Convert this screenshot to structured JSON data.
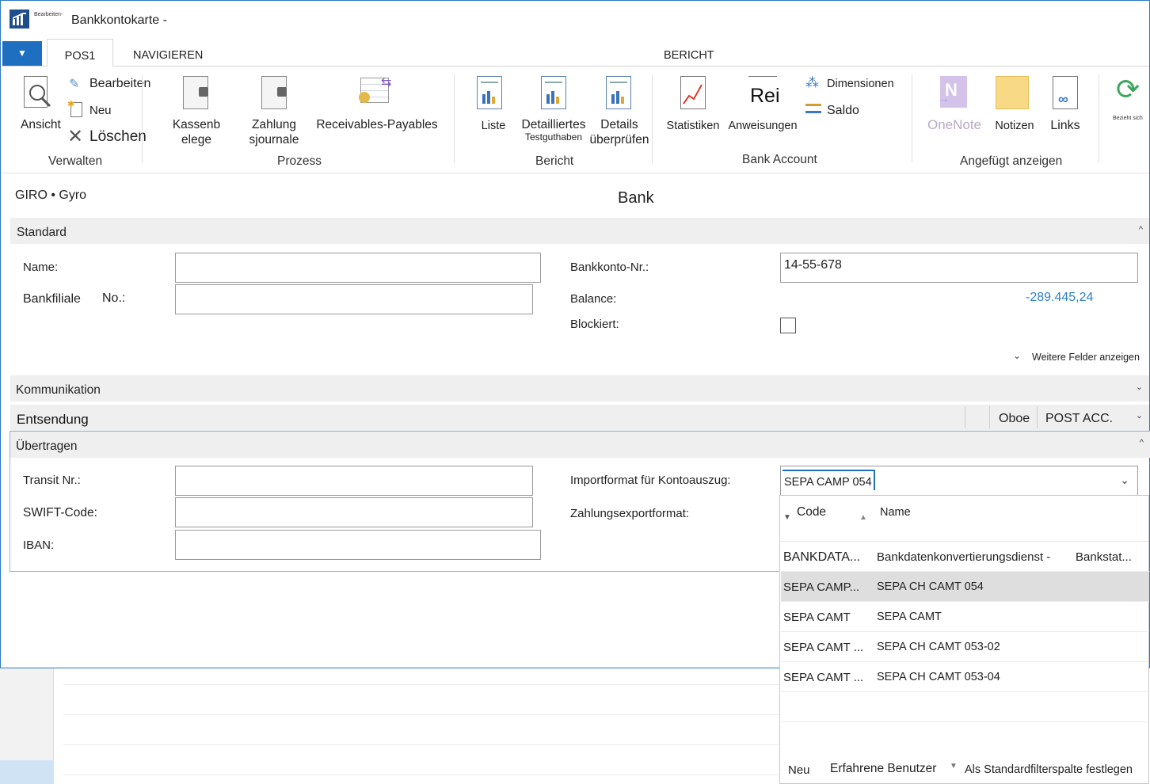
{
  "window": {
    "title": "Bankkontokarte -",
    "logo_caption": "Bearbeiten-"
  },
  "ribbon_tabs": {
    "file_icon": "chevron-down-icon",
    "tabs": [
      "POS1",
      "NAVIGIEREN",
      "BERICHT"
    ]
  },
  "ribbon": {
    "verwalten": {
      "ansicht": "Ansicht",
      "bearbeiten": "Bearbeiten",
      "neu": "Neu",
      "loeschen": "Löschen",
      "label": "Verwalten"
    },
    "prozess": {
      "kassenbelege_1": "Kassenb",
      "kassenbelege_2": "elege",
      "zahlung_1": "Zahlung",
      "zahlung_2": "sjournale",
      "receivables": "Receivables-Payables",
      "label": "Prozess"
    },
    "bericht": {
      "liste": "Liste",
      "detailliertes": "Detailliertes",
      "testguthaben": "Testguthaben",
      "details_1": "Details",
      "details_2": "überprüfen",
      "label": "Bericht"
    },
    "bank_account": {
      "statistiken": "Statistiken",
      "rei": "Rei",
      "anweisungen": "Anweisungen",
      "dimensionen": "Dimensionen",
      "saldo": "Saldo",
      "label": "Bank Account"
    },
    "angefuegt": {
      "onenote": "OneNote",
      "notizen": "Notizen",
      "links": "Links",
      "label": "Angefügt anzeigen"
    },
    "refresh_caption": "Bezieht sich"
  },
  "header": {
    "record_id": "GIRO • Gyro",
    "page_title": "Bank"
  },
  "standard": {
    "title": "Standard",
    "name_label": "Name:",
    "name_value": "",
    "bankfiliale_label": "Bankfiliale",
    "no_label": "No.:",
    "bankfiliale_value": "",
    "bankkonto_label": "Bankkonto-Nr.:",
    "bankkonto_value": "14-55-678",
    "balance_label": "Balance:",
    "balance_value": "-289.445,24",
    "blockiert_label": "Blockiert:",
    "weitere_felder": "Weitere Felder anzeigen"
  },
  "kommunikation": {
    "title": "Kommunikation"
  },
  "entsendung": {
    "title": "Entsendung",
    "oboe": "Oboe",
    "post_acc": "POST ACC."
  },
  "uebertragen": {
    "title": "Übertragen",
    "transit_label": "Transit Nr.:",
    "swift_label": "SWIFT-Code:",
    "iban_label": "IBAN:",
    "importformat_label": "Importformat für Kontoauszug:",
    "importformat_value": "SEPA CAMP 054",
    "zahlungsexport_label": "Zahlungsexportformat:"
  },
  "dropdown": {
    "col_code": "Code",
    "col_name": "Name",
    "rows": [
      {
        "code": "BANKDATA...",
        "name": "Bankdatenkonvertierungsdienst -",
        "extra": "Bankstat..."
      },
      {
        "code": "SEPA CAMP...",
        "name": "SEPA CH CAMT 054",
        "extra": ""
      },
      {
        "code": "SEPA CAMT",
        "name": "SEPA CAMT",
        "extra": ""
      },
      {
        "code": "SEPA CAMT ...",
        "name": "SEPA CH CAMT 053-02",
        "extra": ""
      },
      {
        "code": "SEPA CAMT ...",
        "name": "SEPA CH CAMT 053-04",
        "extra": ""
      }
    ],
    "footer_neu": "Neu",
    "footer_erfahrene": "Erfahrene Benutzer",
    "footer_filter": "Als Standardfilterspalte festlegen"
  },
  "colors": {
    "accent": "#2b79c2",
    "file_button": "#1e6fbf",
    "balance": "#2f7fc9",
    "section_bg": "#efefef",
    "selected_row": "#dedede"
  }
}
